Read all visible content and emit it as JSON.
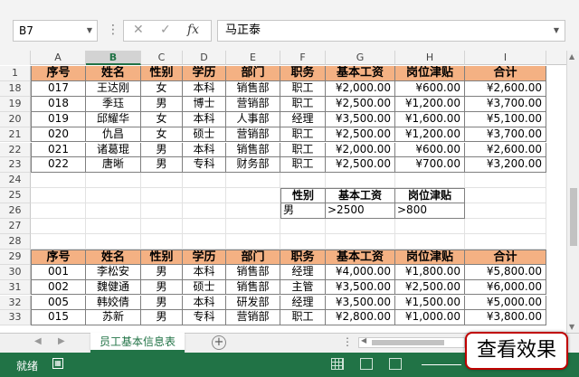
{
  "formula_bar": {
    "name_box": "B7",
    "name_box_dropdown": "▼",
    "separator": "⋮",
    "cancel_icon": "✕",
    "enter_icon": "✓",
    "fx_label": "fx",
    "value": "马正泰",
    "expand_icon": "▼"
  },
  "columns": [
    "A",
    "B",
    "C",
    "D",
    "E",
    "F",
    "G",
    "H",
    "I"
  ],
  "selected_column": "B",
  "rows": [
    {
      "num": "1",
      "type": "header",
      "cells": [
        "序号",
        "姓名",
        "性别",
        "学历",
        "部门",
        "职务",
        "基本工资",
        "岗位津贴",
        "合计"
      ]
    },
    {
      "num": "18",
      "type": "data",
      "cells": [
        "017",
        "王达刚",
        "女",
        "本科",
        "销售部",
        "职工",
        "¥2,000.00",
        "¥600.00",
        "¥2,600.00"
      ]
    },
    {
      "num": "19",
      "type": "data",
      "cells": [
        "018",
        "季珏",
        "男",
        "博士",
        "营销部",
        "职工",
        "¥2,500.00",
        "¥1,200.00",
        "¥3,700.00"
      ]
    },
    {
      "num": "20",
      "type": "data",
      "cells": [
        "019",
        "邱耀华",
        "女",
        "本科",
        "人事部",
        "经理",
        "¥3,500.00",
        "¥1,600.00",
        "¥5,100.00"
      ]
    },
    {
      "num": "21",
      "type": "data",
      "cells": [
        "020",
        "仇昌",
        "女",
        "硕士",
        "营销部",
        "职工",
        "¥2,500.00",
        "¥1,200.00",
        "¥3,700.00"
      ]
    },
    {
      "num": "22",
      "type": "data",
      "cells": [
        "021",
        "诸葛琨",
        "男",
        "本科",
        "销售部",
        "职工",
        "¥2,000.00",
        "¥600.00",
        "¥2,600.00"
      ]
    },
    {
      "num": "23",
      "type": "data",
      "cells": [
        "022",
        "唐晰",
        "男",
        "专科",
        "财务部",
        "职工",
        "¥2,500.00",
        "¥700.00",
        "¥3,200.00"
      ]
    },
    {
      "num": "24",
      "type": "blank",
      "cells": []
    },
    {
      "num": "25",
      "type": "criteria-header",
      "cells": [
        "性别",
        "基本工资",
        "岗位津贴"
      ]
    },
    {
      "num": "26",
      "type": "criteria",
      "cells": [
        "男",
        ">2500",
        ">800"
      ]
    },
    {
      "num": "27",
      "type": "blank",
      "cells": []
    },
    {
      "num": "28",
      "type": "blank",
      "cells": []
    },
    {
      "num": "29",
      "type": "header",
      "cells": [
        "序号",
        "姓名",
        "性别",
        "学历",
        "部门",
        "职务",
        "基本工资",
        "岗位津贴",
        "合计"
      ]
    },
    {
      "num": "30",
      "type": "data",
      "cells": [
        "001",
        "李松安",
        "男",
        "本科",
        "销售部",
        "经理",
        "¥4,000.00",
        "¥1,800.00",
        "¥5,800.00"
      ]
    },
    {
      "num": "31",
      "type": "data",
      "cells": [
        "002",
        "魏健通",
        "男",
        "硕士",
        "销售部",
        "主管",
        "¥3,500.00",
        "¥2,500.00",
        "¥6,000.00"
      ]
    },
    {
      "num": "32",
      "type": "data",
      "cells": [
        "005",
        "韩姣倩",
        "男",
        "本科",
        "研发部",
        "经理",
        "¥3,500.00",
        "¥1,500.00",
        "¥5,000.00"
      ]
    },
    {
      "num": "33",
      "type": "data",
      "cells": [
        "015",
        "苏新",
        "男",
        "专科",
        "营销部",
        "职工",
        "¥2,800.00",
        "¥1,000.00",
        "¥3,800.00"
      ]
    }
  ],
  "sheet_tab": "员工基本信息表",
  "add_sheet": "+",
  "tab_nav_prev": "◀",
  "tab_nav_next": "▶",
  "tab_dots": "⋮",
  "status_text": "就绪",
  "overlay_button": "查看效果",
  "colors": {
    "header_fill": "#f4b183",
    "accent": "#217346",
    "overlay_border": "#c00000"
  }
}
